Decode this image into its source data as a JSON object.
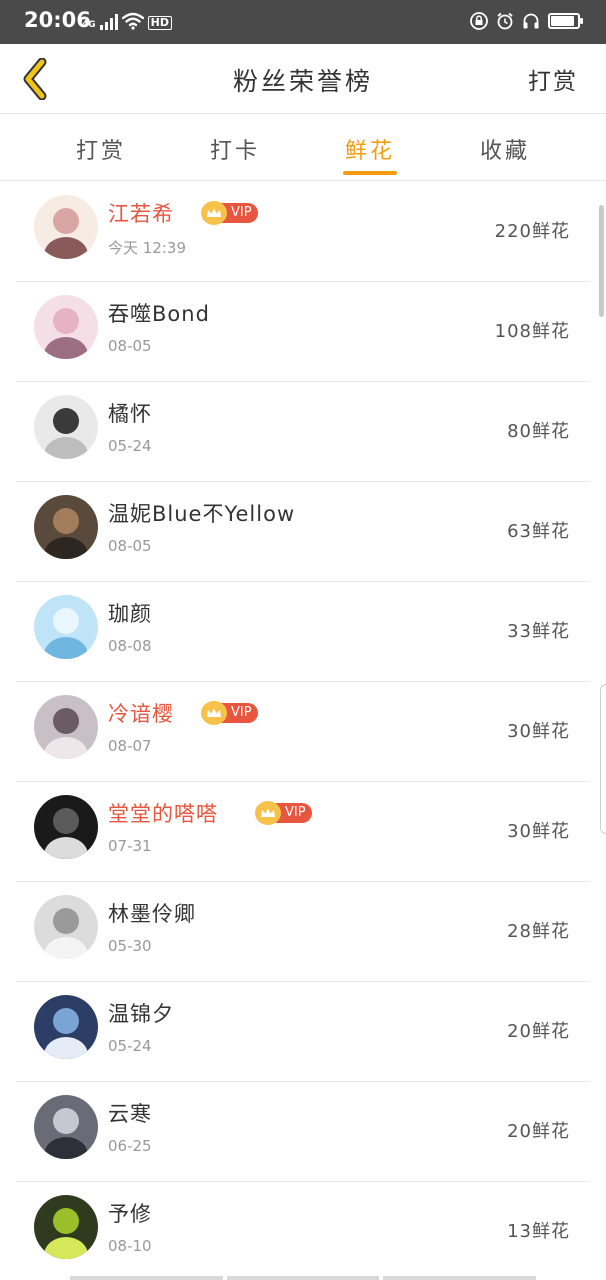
{
  "status_bar": {
    "time": "20:06",
    "network": "4G",
    "hd": "HD",
    "icons": [
      "signal-icon",
      "wifi-icon",
      "lock-icon",
      "alarm-icon",
      "headphones-icon",
      "battery-icon"
    ],
    "battery_level": 0.9
  },
  "header": {
    "back_icon": "chevron-left-icon",
    "title": "粉丝荣誉榜",
    "action": "打赏"
  },
  "tabs": [
    {
      "label": "打赏",
      "active": false
    },
    {
      "label": "打卡",
      "active": false
    },
    {
      "label": "鲜花",
      "active": true
    },
    {
      "label": "收藏",
      "active": false
    }
  ],
  "vip_label": "VIP",
  "colors": {
    "accent": "#f39c12",
    "vip_name": "#e8563f",
    "vip_badge": "#e8563f",
    "crown": "#f6c24a"
  },
  "fans": [
    {
      "name": "江若希",
      "vip": true,
      "date": "今天 12:39",
      "amount": "220鲜花"
    },
    {
      "name": "吞噬Bond",
      "vip": false,
      "date": "08-05",
      "amount": "108鲜花"
    },
    {
      "name": "橘怀",
      "vip": false,
      "date": "05-24",
      "amount": "80鲜花"
    },
    {
      "name": "温妮Blue不Yellow",
      "vip": false,
      "date": "08-05",
      "amount": "63鲜花"
    },
    {
      "name": "珈颜",
      "vip": false,
      "date": "08-08",
      "amount": "33鲜花"
    },
    {
      "name": "冷谙樱",
      "vip": true,
      "date": "08-07",
      "amount": "30鲜花"
    },
    {
      "name": "堂堂的嗒嗒",
      "vip": true,
      "date": "07-31",
      "amount": "30鲜花"
    },
    {
      "name": "林墨伶卿",
      "vip": false,
      "date": "05-30",
      "amount": "28鲜花"
    },
    {
      "name": "温锦夕",
      "vip": false,
      "date": "05-24",
      "amount": "20鲜花"
    },
    {
      "name": "云寒",
      "vip": false,
      "date": "06-25",
      "amount": "20鲜花"
    },
    {
      "name": "予修",
      "vip": false,
      "date": "08-10",
      "amount": "13鲜花"
    }
  ]
}
